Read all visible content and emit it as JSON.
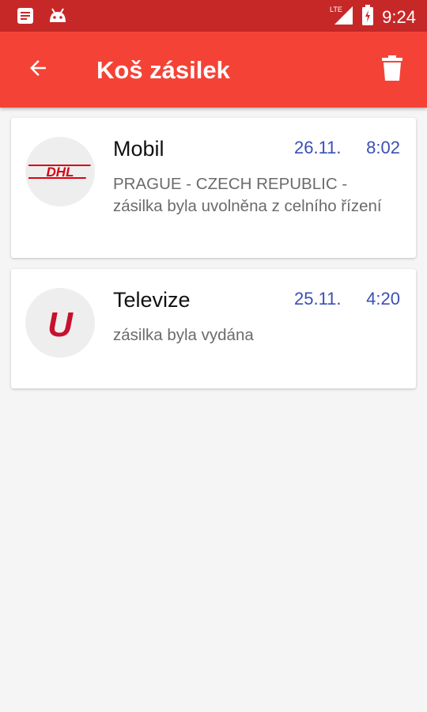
{
  "status_bar": {
    "time": "9:24",
    "network": "LTE",
    "icons": [
      "notes-icon",
      "android-icon",
      "signal-icon",
      "battery-icon"
    ]
  },
  "app_bar": {
    "title": "Koš zásilek",
    "back_icon": "arrow-left-icon",
    "action_icon": "trash-icon",
    "background_color": "#f44336"
  },
  "parcels": [
    {
      "name": "Mobil",
      "date": "26.11.",
      "time": "8:02",
      "status": "PRAGUE - CZECH REPUBLIC - zásilka byla uvolněna z celního řízení",
      "carrier_logo": "DHL"
    },
    {
      "name": "Televize",
      "date": "25.11.",
      "time": "4:20",
      "status": "zásilka byla vydána",
      "carrier_logo": "U"
    }
  ],
  "colors": {
    "status_bar": "#c62828",
    "date_text": "#3a4fb5",
    "brand_red": "#d40511"
  }
}
